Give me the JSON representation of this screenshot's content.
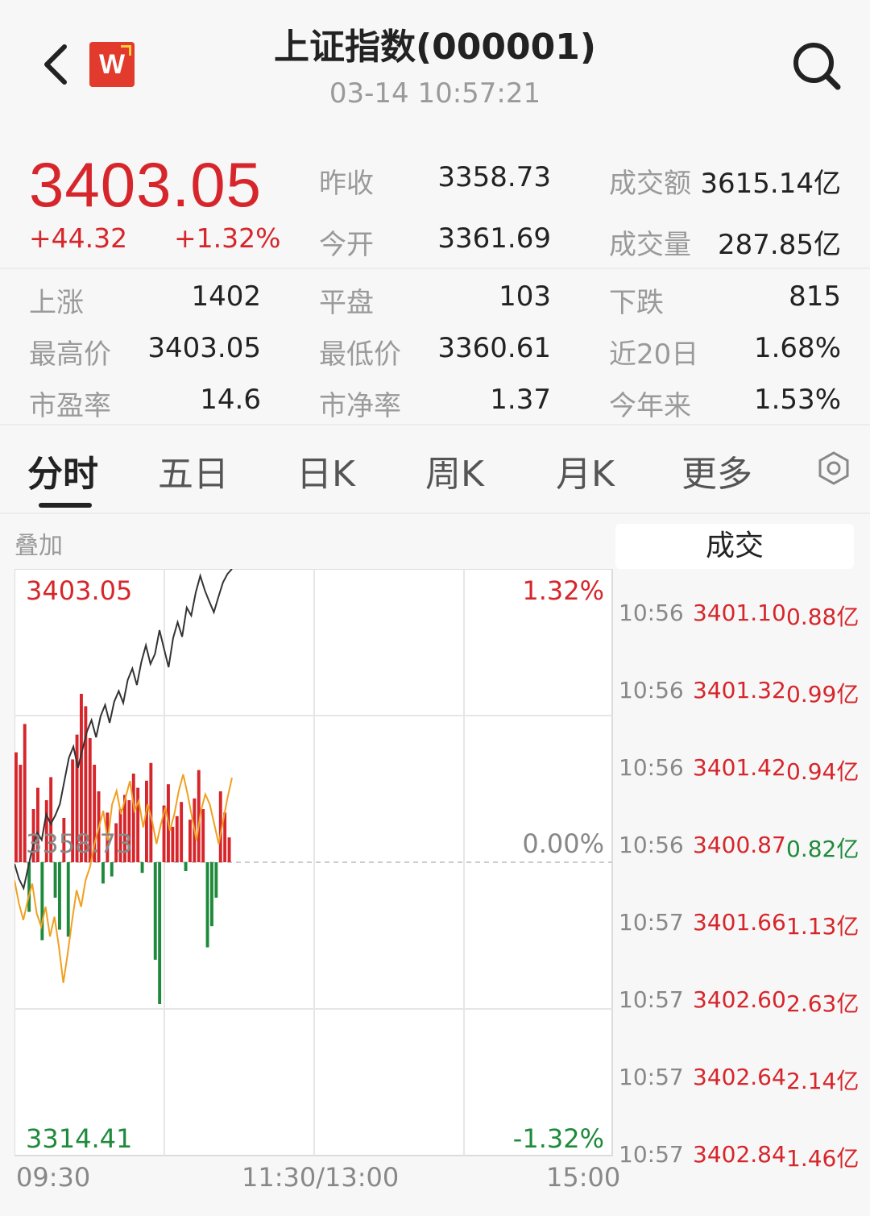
{
  "header": {
    "title": "上证指数(000001)",
    "datetime": "03-14 10:57:21",
    "logo_text": "W"
  },
  "quote": {
    "price": "3403.05",
    "change": "+44.32",
    "change_pct": "+1.32%",
    "prev_close_label": "昨收",
    "prev_close": "3358.73",
    "open_label": "今开",
    "open": "3361.69",
    "turnover_label": "成交额",
    "turnover": "3615.14亿",
    "volume_label": "成交量",
    "volume": "287.85亿"
  },
  "stats": [
    [
      {
        "label": "上涨",
        "value": "1402"
      },
      {
        "label": "平盘",
        "value": "103"
      },
      {
        "label": "下跌",
        "value": "815"
      }
    ],
    [
      {
        "label": "最高价",
        "value": "3403.05"
      },
      {
        "label": "最低价",
        "value": "3360.61"
      },
      {
        "label": "近20日",
        "value": "1.68%"
      }
    ],
    [
      {
        "label": "市盈率",
        "value": "14.6"
      },
      {
        "label": "市净率",
        "value": "1.37"
      },
      {
        "label": "今年来",
        "value": "1.53%"
      }
    ]
  ],
  "tabs": [
    "分时",
    "五日",
    "日K",
    "周K",
    "月K",
    "更多"
  ],
  "active_tab": "分时",
  "chart": {
    "overlay_label": "叠加",
    "y_top": "3403.05",
    "y_mid": "3358.73",
    "y_bottom": "3314.41",
    "pct_top": "1.32%",
    "pct_mid": "0.00%",
    "pct_bottom": "-1.32%",
    "time_start": "09:30",
    "time_mid": "11:30/13:00",
    "time_end": "15:00"
  },
  "chart_data": {
    "type": "line",
    "y_range": [
      3314.41,
      3403.05
    ],
    "prev_close": 3358.73,
    "pct_range": [
      -1.32,
      1.32
    ],
    "x_range": [
      "09:30",
      "15:00"
    ],
    "series": [
      {
        "values": [
          3358.5,
          3356.2,
          3354.8,
          3357.9,
          3361.0,
          3363.2,
          3362.1,
          3366.0,
          3364.5,
          3365.8,
          3367.5,
          3371.0,
          3374.5,
          3376.2,
          3373.0,
          3375.8,
          3378.5,
          3380.2,
          3377.6,
          3380.8,
          3382.5,
          3379.8,
          3383.0,
          3384.6,
          3382.8,
          3386.3,
          3388.0,
          3385.5,
          3389.0,
          3391.5,
          3388.7,
          3390.2,
          3393.8,
          3391.0,
          3388.2,
          3392.6,
          3395.0,
          3392.8,
          3397.2,
          3396.0,
          3399.5,
          3402.0,
          3399.8,
          3398.1,
          3396.5,
          3398.8,
          3401.0,
          3402.3,
          3403.05
        ]
      }
    ],
    "volume_bars": [
      {
        "dir": "up",
        "v": 0.62
      },
      {
        "dir": "up",
        "v": 0.55
      },
      {
        "dir": "up",
        "v": 0.78
      },
      {
        "dir": "down",
        "v": 0.28
      },
      {
        "dir": "up",
        "v": 0.3
      },
      {
        "dir": "up",
        "v": 0.42
      },
      {
        "dir": "down",
        "v": 0.44
      },
      {
        "dir": "up",
        "v": 0.35
      },
      {
        "dir": "up",
        "v": 0.48
      },
      {
        "dir": "down",
        "v": 0.2
      },
      {
        "dir": "down",
        "v": 0.38
      },
      {
        "dir": "up",
        "v": 0.25
      },
      {
        "dir": "down",
        "v": 0.42
      },
      {
        "dir": "up",
        "v": 0.58
      },
      {
        "dir": "up",
        "v": 0.72
      },
      {
        "dir": "up",
        "v": 0.95
      },
      {
        "dir": "up",
        "v": 0.88
      },
      {
        "dir": "up",
        "v": 0.7
      },
      {
        "dir": "up",
        "v": 0.55
      },
      {
        "dir": "up",
        "v": 0.4
      },
      {
        "dir": "down",
        "v": 0.12
      },
      {
        "dir": "up",
        "v": 0.28
      },
      {
        "dir": "down",
        "v": 0.08
      },
      {
        "dir": "up",
        "v": 0.22
      },
      {
        "dir": "up",
        "v": 0.3
      },
      {
        "dir": "up",
        "v": 0.38
      },
      {
        "dir": "up",
        "v": 0.35
      },
      {
        "dir": "up",
        "v": 0.5
      },
      {
        "dir": "up",
        "v": 0.42
      },
      {
        "dir": "down",
        "v": 0.06
      },
      {
        "dir": "up",
        "v": 0.46
      },
      {
        "dir": "up",
        "v": 0.56
      },
      {
        "dir": "down",
        "v": 0.55
      },
      {
        "dir": "down",
        "v": 0.8
      },
      {
        "dir": "up",
        "v": 0.32
      },
      {
        "dir": "up",
        "v": 0.44
      },
      {
        "dir": "up",
        "v": 0.2
      },
      {
        "dir": "up",
        "v": 0.26
      },
      {
        "dir": "up",
        "v": 0.34
      },
      {
        "dir": "down",
        "v": 0.05
      },
      {
        "dir": "up",
        "v": 0.24
      },
      {
        "dir": "up",
        "v": 0.36
      },
      {
        "dir": "up",
        "v": 0.52
      },
      {
        "dir": "up",
        "v": 0.3
      },
      {
        "dir": "down",
        "v": 0.48
      },
      {
        "dir": "down",
        "v": 0.36
      },
      {
        "dir": "down",
        "v": 0.2
      },
      {
        "dir": "up",
        "v": 0.4
      },
      {
        "dir": "up",
        "v": 0.28
      },
      {
        "dir": "up",
        "v": 0.14
      }
    ],
    "avg_line": [
      3356.0,
      3352.5,
      3350.0,
      3353.0,
      3355.5,
      3351.0,
      3349.0,
      3352.0,
      3347.5,
      3350.5,
      3346.0,
      3340.5,
      3345.0,
      3350.0,
      3354.5,
      3352.0,
      3356.0,
      3358.0,
      3361.5,
      3364.0,
      3366.5,
      3362.0,
      3367.5,
      3369.5,
      3366.0,
      3368.5,
      3371.0,
      3366.5,
      3368.0,
      3364.0,
      3367.5,
      3365.0,
      3361.5,
      3364.5,
      3367.0,
      3363.5,
      3366.0,
      3369.5,
      3372.0,
      3369.0,
      3365.5,
      3362.0,
      3366.5,
      3369.0,
      3367.5,
      3364.5,
      3361.5,
      3365.0,
      3368.5,
      3371.5
    ]
  },
  "trades": {
    "header": "成交",
    "rows": [
      {
        "time": "10:56",
        "price": "3401.10",
        "vol": "0.88亿",
        "dir": "up"
      },
      {
        "time": "10:56",
        "price": "3401.32",
        "vol": "0.99亿",
        "dir": "up"
      },
      {
        "time": "10:56",
        "price": "3401.42",
        "vol": "0.94亿",
        "dir": "up"
      },
      {
        "time": "10:56",
        "price": "3400.87",
        "vol": "0.82亿",
        "dir": "down"
      },
      {
        "time": "10:57",
        "price": "3401.66",
        "vol": "1.13亿",
        "dir": "up"
      },
      {
        "time": "10:57",
        "price": "3402.60",
        "vol": "2.63亿",
        "dir": "up"
      },
      {
        "time": "10:57",
        "price": "3402.64",
        "vol": "2.14亿",
        "dir": "up"
      },
      {
        "time": "10:57",
        "price": "3402.84",
        "vol": "1.46亿",
        "dir": "up"
      }
    ]
  },
  "colors": {
    "up": "#d6262b",
    "down": "#1f8a3b",
    "avg": "#f0a020",
    "line": "#333333"
  },
  "icons": [
    "back-arrow-icon",
    "search-icon",
    "settings-icon"
  ]
}
